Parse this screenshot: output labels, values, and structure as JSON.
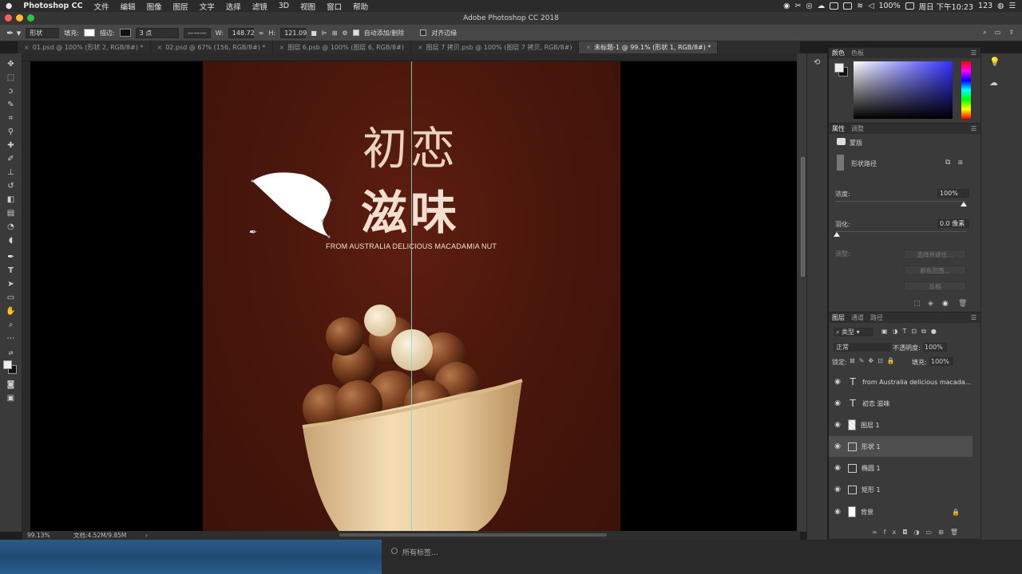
{
  "menubar": {
    "apple": "",
    "app": "Photoshop CC",
    "items": [
      "文件",
      "编辑",
      "图像",
      "图层",
      "文字",
      "选择",
      "滤镜",
      "3D",
      "视图",
      "窗口",
      "帮助"
    ],
    "battery": "100%",
    "clock": "周日 下午10:23",
    "user": "123"
  },
  "window": {
    "title": "Adobe Photoshop CC 2018"
  },
  "options": {
    "mode": "形状",
    "fill_label": "填充:",
    "stroke_label": "描边:",
    "stroke_size": "3 点",
    "w_label": "W:",
    "w_value": "148.72",
    "h_label": "H:",
    "h_value": "121.09",
    "auto_add": "自动添加/删除",
    "align_edges": "对齐边缘"
  },
  "tabs": [
    {
      "label": "01.psd @ 100% (形状 2, RGB/8#) *",
      "active": false
    },
    {
      "label": "02.psd @ 67% (156, RGB/8#) *",
      "active": false
    },
    {
      "label": "图层 6.psb @ 100% (图层 6, RGB/8#)",
      "active": false
    },
    {
      "label": "图层 7 拷贝.psb @ 100% (图层 7 拷贝, RGB/8#)",
      "active": false
    },
    {
      "label": "未标题-1 @ 99.1% (形状 1, RGB/8#) *",
      "active": true
    }
  ],
  "canvas": {
    "title_line1": "初恋",
    "title_line2": "滋味",
    "subtitle": "FROM AUSTRALIA DELICIOUS MACADAMIA NUT"
  },
  "status": {
    "zoom": "99.13%",
    "doc": "文档:4.52M/9.85M",
    "arrow": "›"
  },
  "tags": {
    "all_tags": "所有标签..."
  },
  "color_panel": {
    "tab_color": "颜色",
    "tab_swatches": "色板"
  },
  "props_panel": {
    "tab_props": "属性",
    "tab_adjust": "调整",
    "mask_label": "蒙版",
    "shape_path": "形状路径",
    "density_label": "浓度:",
    "density_value": "100%",
    "feather_label": "羽化:",
    "feather_value": "0.0 像素",
    "refine_label": "调整:",
    "btn_select_mask": "选择并遮住...",
    "btn_color_range": "颜色范围...",
    "btn_invert": "反相"
  },
  "layers_panel": {
    "tab_layers": "图层",
    "tab_channels": "通道",
    "tab_paths": "路径",
    "filter_kind": "类型",
    "blend_mode": "正常",
    "opacity_label": "不透明度:",
    "opacity_value": "100%",
    "lock_label": "锁定:",
    "fill_label": "填充:",
    "fill_value": "100%",
    "layers": [
      {
        "name": "from Australia delicious macada...",
        "kind": "text",
        "selected": false
      },
      {
        "name": "初恋 滋味",
        "kind": "text",
        "selected": false
      },
      {
        "name": "图层 1",
        "kind": "pixel",
        "selected": false
      },
      {
        "name": "形状 1",
        "kind": "shape",
        "selected": true
      },
      {
        "name": "椭圆 1",
        "kind": "shape",
        "selected": false
      },
      {
        "name": "矩形 1",
        "kind": "shape",
        "selected": false
      },
      {
        "name": "背景",
        "kind": "pixel",
        "selected": false,
        "locked": true
      }
    ]
  }
}
